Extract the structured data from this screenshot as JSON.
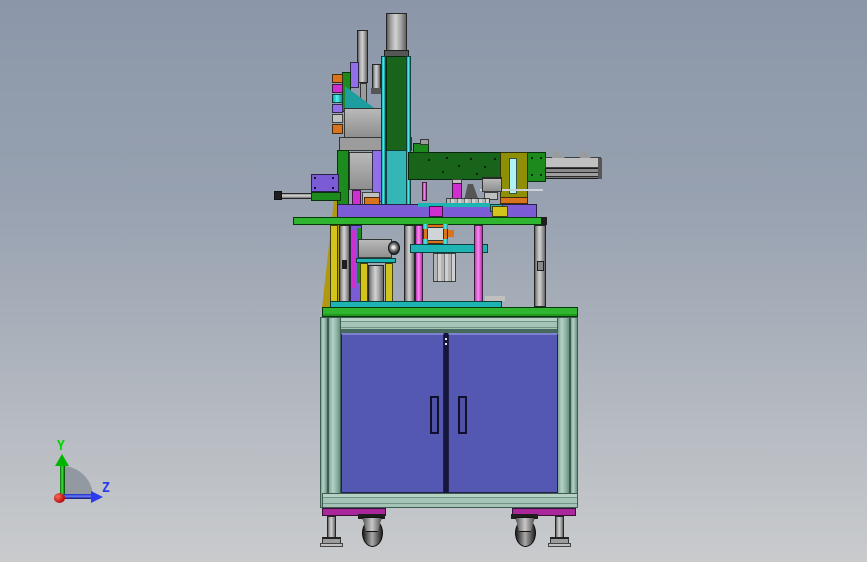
{
  "scene": {
    "type": "cad-3d-viewport",
    "view": "side-elevation",
    "background_top": "#8b97a9",
    "background_bottom": "#c9cbcd"
  },
  "axis_triad": {
    "y_label": "Y",
    "z_label": "Z",
    "y_color": "#00d800",
    "z_color": "#2b3cf0",
    "origin_color": "#c01010"
  },
  "palette": {
    "bg-top": "#8b97a9",
    "bg-bottom": "#c9cbcd",
    "green-dark": "#17641a",
    "green-mid": "#1d8a1d",
    "green-bright": "#27ad27",
    "cyan": "#2ae2e2",
    "teal-panel": "#34b6b6",
    "teal-beam": "#1fb4b4",
    "teal-tri": "#1d9d9d",
    "door-blue": "#5558b2",
    "frame-pale": "#a5c3b7",
    "frame-dark": "#46695e",
    "purple": "#7b5cd6",
    "purple-light": "#916fe6",
    "magenta": "#cf2fcf",
    "pink": "#ee6ae4",
    "base-magenta": "#a9279b",
    "yellow": "#d2c31d",
    "olive": "#8f8f06",
    "mustard": "#b0980f",
    "orange": "#d8741c",
    "gray-metal": "#9c9c9c",
    "gray-light": "#c0c0c0",
    "gray-dark": "#565656",
    "near-black": "#1e1e1e"
  }
}
